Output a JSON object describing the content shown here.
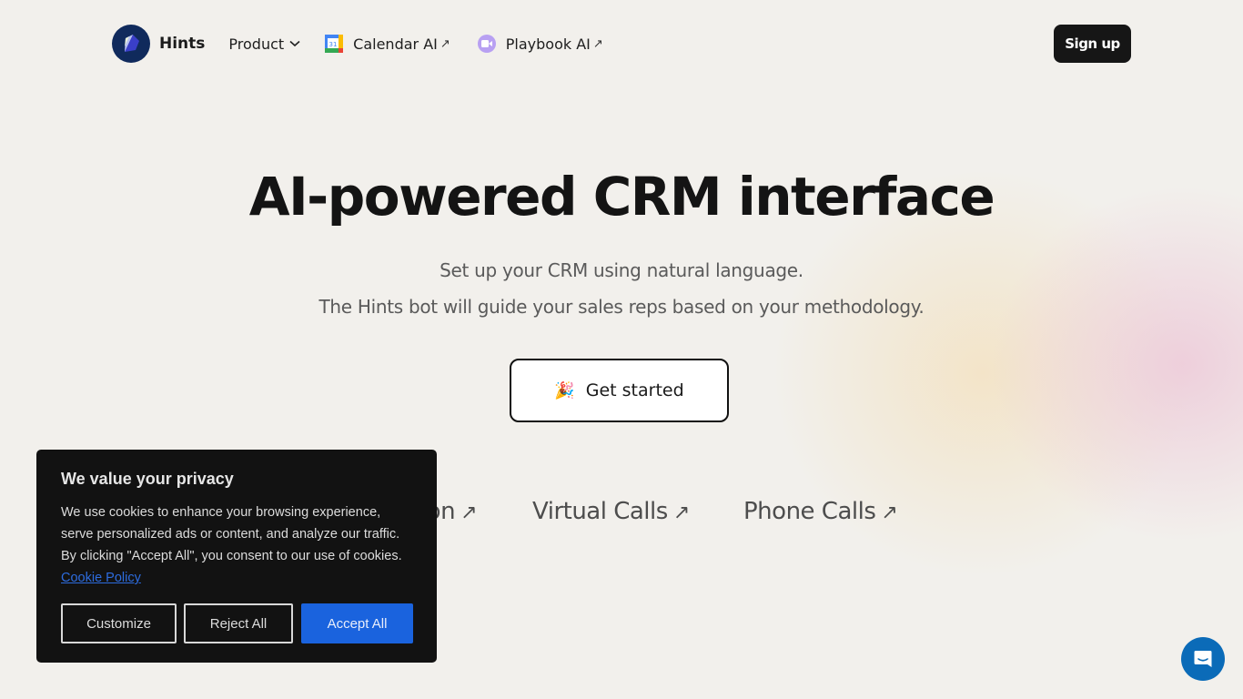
{
  "nav": {
    "brand": "Hints",
    "product_label": "Product",
    "calendar_label": "Calendar AI",
    "playbook_label": "Playbook AI",
    "external_arrow": "↗",
    "calendar_icon_day": "31",
    "signup_label": "Sign up"
  },
  "hero": {
    "title": "AI-powered CRM interface",
    "subtitle_line1": "Set up your CRM using natural language.",
    "subtitle_line2": "The Hints bot will guide your sales reps based on your methodology.",
    "cta_emoji": "🎉",
    "cta_label": "Get started"
  },
  "feature_links": [
    {
      "label": "on",
      "arrow": "↗"
    },
    {
      "label": "Virtual Calls",
      "arrow": "↗"
    },
    {
      "label": "Phone Calls",
      "arrow": "↗"
    }
  ],
  "cookie_banner": {
    "title": "We value your privacy",
    "body": "We use cookies to enhance your browsing experience, serve personalized ads or content, and analyze our traffic. By clicking \"Accept All\", you consent to our use of cookies.",
    "policy_link": "Cookie Policy",
    "customize_label": "Customize",
    "reject_label": "Reject All",
    "accept_label": "Accept All"
  },
  "colors": {
    "background": "#f2f0ec",
    "accent_blue": "#1a63de",
    "logo_navy": "#102a5c",
    "chat_blue": "#0b6bb8",
    "dark_button": "#161616"
  }
}
